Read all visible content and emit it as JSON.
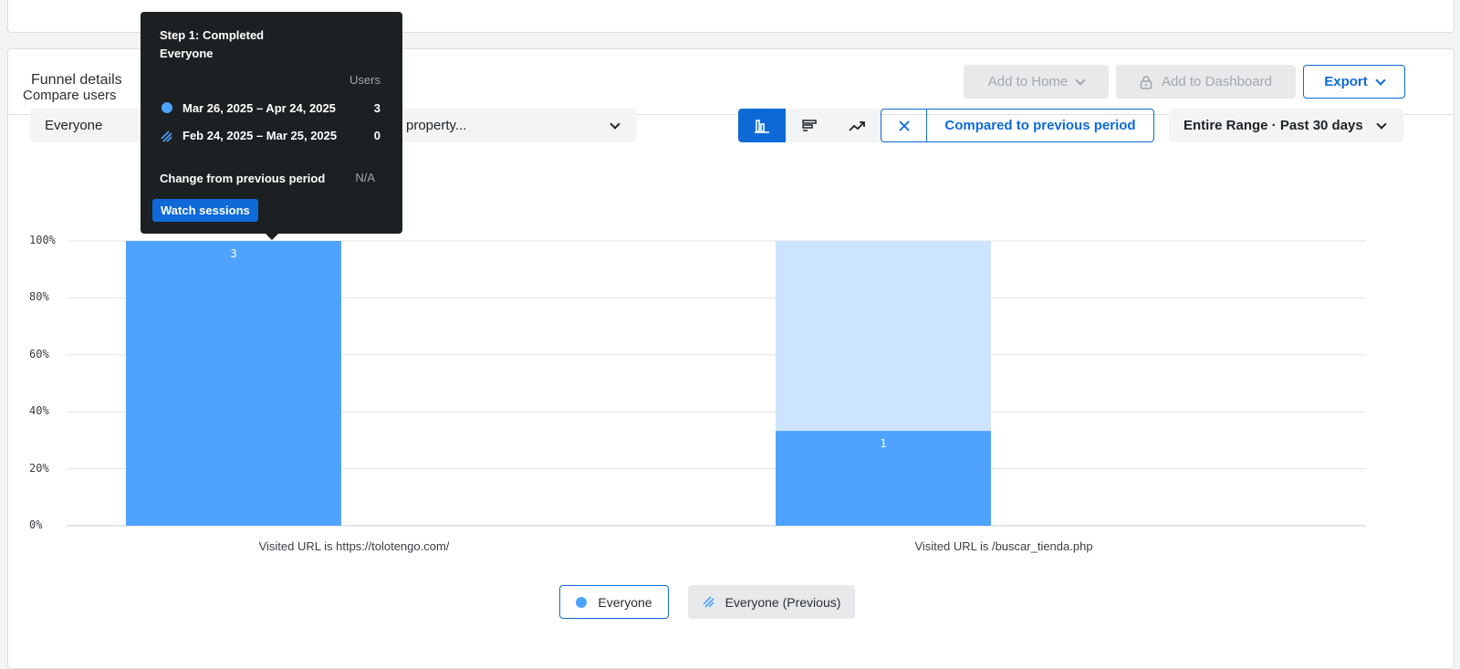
{
  "panel": {
    "title": "Funnel details",
    "add_home": "Add to Home",
    "add_dashboard": "Add to Dashboard",
    "export": "Export"
  },
  "compare": {
    "label": "Compare users",
    "segment": "Everyone",
    "property_placeholder": "property...",
    "compared_label": "Compared to previous period",
    "range": "Entire Range · Past 30 days"
  },
  "chart_data": {
    "type": "bar",
    "categories": [
      "Visited URL is https://tolotengo.com/",
      "Visited URL is /buscar_tienda.php"
    ],
    "series": [
      {
        "name": "Everyone",
        "values": [
          100,
          33.3
        ],
        "labels": [
          "3",
          "1"
        ],
        "color": "#4fa3ff"
      },
      {
        "name": "Everyone (Previous)",
        "values": [
          0,
          0
        ],
        "labels": [
          "",
          ""
        ],
        "color": "#cce4fd"
      }
    ],
    "dropoff_color": "#cce4fd",
    "yticks": [
      "0%",
      "20%",
      "40%",
      "60%",
      "80%",
      "100%"
    ],
    "ylim": [
      0,
      100
    ],
    "grid": true,
    "legend": "bottom-center"
  },
  "legend": {
    "current": "Everyone",
    "previous": "Everyone (Previous)"
  },
  "tooltip": {
    "title": "Step 1: Completed",
    "subtitle": "Everyone",
    "col_header": "Users",
    "row1_label": "Mar 26, 2025 – Apr 24, 2025",
    "row1_value": "3",
    "row2_label": "Feb 24, 2025 – Mar 25, 2025",
    "row2_value": "0",
    "change_label": "Change from previous period",
    "change_value": "N/A",
    "button": "Watch sessions"
  },
  "icons": {
    "chart_bar": "bar-chart-icon",
    "chart_horizontal": "horizontal-bar-icon",
    "chart_trend": "trend-line-icon",
    "lock": "lock-icon",
    "close": "close-icon"
  }
}
